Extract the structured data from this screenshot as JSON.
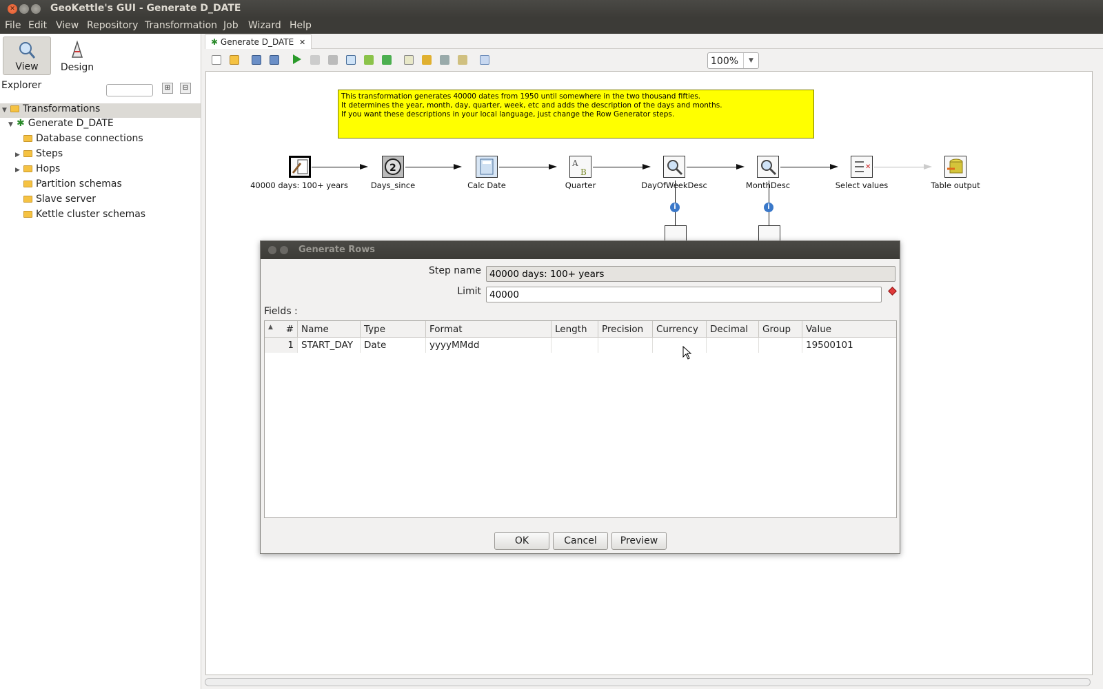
{
  "window": {
    "title": "GeoKettle's GUI - Generate D_DATE"
  },
  "menu": [
    "File",
    "Edit",
    "View",
    "Repository",
    "Transformation",
    "Job",
    "Wizard",
    "Help"
  ],
  "perspectives": {
    "view": "View",
    "design": "Design"
  },
  "explorer": {
    "label": "Explorer"
  },
  "tree": {
    "root": "Transformations",
    "transformation": "Generate D_DATE",
    "items": [
      "Database connections",
      "Steps",
      "Hops",
      "Partition schemas",
      "Slave server",
      "Kettle cluster schemas"
    ]
  },
  "tab": {
    "label": "Generate D_DATE"
  },
  "toolbar": {
    "zoom": "100%"
  },
  "note": {
    "lines": [
      "This transformation generates 40000 dates from 1950 until somewhere in the two thousand fifties.",
      "It determines the year, month, day, quarter, week, etc and adds the description of the days and months.",
      "If you want these descriptions in your local language, just change the Row Generator steps."
    ]
  },
  "steps": [
    "40000 days: 100+ years",
    "Days_since",
    "Calc Date",
    "Quarter",
    "DayOfWeekDesc",
    "MonthDesc",
    "Select values",
    "Table output"
  ],
  "dialog": {
    "title": "Generate Rows",
    "step_name_label": "Step name",
    "step_name_value": "40000 days: 100+ years",
    "limit_label": "Limit",
    "limit_value": "40000",
    "fields_label": "Fields :",
    "columns": [
      "#",
      "Name",
      "Type",
      "Format",
      "Length",
      "Precision",
      "Currency",
      "Decimal",
      "Group",
      "Value"
    ],
    "rows": [
      {
        "num": "1",
        "name": "START_DAY",
        "type": "Date",
        "format": "yyyyMMdd",
        "length": "",
        "precision": "",
        "currency": "",
        "decimal": "",
        "group": "",
        "value": "19500101"
      }
    ],
    "buttons": {
      "ok": "OK",
      "cancel": "Cancel",
      "preview": "Preview"
    }
  },
  "colors": {
    "note_bg": "#ffff00",
    "titlebar": "#3c3b37",
    "close_btn": "#e05a2b"
  }
}
